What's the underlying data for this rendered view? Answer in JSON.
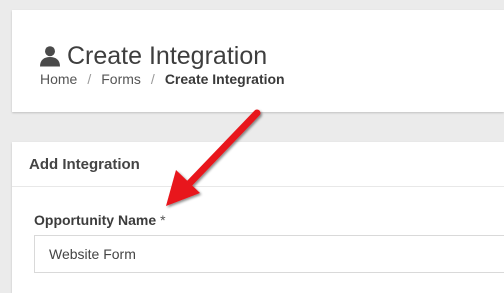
{
  "header": {
    "title": "Create Integration",
    "icon": "user-icon",
    "breadcrumb": {
      "home": "Home",
      "forms": "Forms",
      "current": "Create Integration",
      "separator": "/"
    }
  },
  "form_card": {
    "title": "Add Integration",
    "field": {
      "label": "Opportunity Name",
      "required_marker": "*",
      "value": "Website Form"
    }
  },
  "annotation": {
    "arrow_color": "#e8141b"
  }
}
